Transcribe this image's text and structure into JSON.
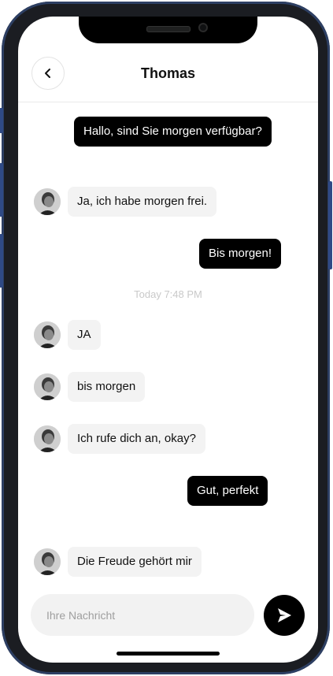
{
  "header": {
    "title": "Thomas"
  },
  "messages": [
    {
      "direction": "out",
      "text": "Hallo, sind Sie morgen verfügbar?"
    },
    {
      "direction": "in",
      "text": "Ja, ich habe morgen frei."
    },
    {
      "direction": "out",
      "text": "Bis morgen!"
    },
    {
      "direction": "in",
      "text": "JA"
    },
    {
      "direction": "in",
      "text": "bis morgen"
    },
    {
      "direction": "in",
      "text": "Ich rufe dich an, okay?"
    },
    {
      "direction": "out",
      "text": "Gut, perfekt"
    },
    {
      "direction": "in",
      "text": "Die Freude gehört mir"
    }
  ],
  "timestamp": "Today 7:48 PM",
  "composer": {
    "placeholder": "Ihre Nachricht"
  },
  "icons": {
    "back": "chevron-left-icon",
    "send": "send-icon"
  },
  "colors": {
    "outgoing_bubble": "#000000",
    "incoming_bubble": "#f3f3f3",
    "frame": "#1b1d22",
    "frame_accent": "#2f4a86"
  }
}
